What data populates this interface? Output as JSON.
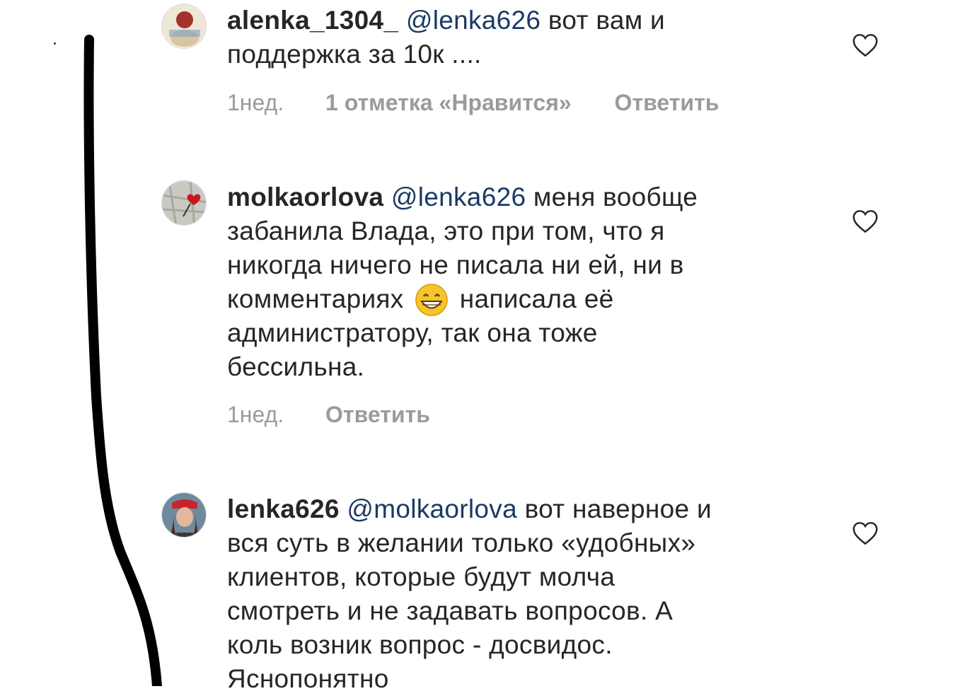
{
  "comments": [
    {
      "username": "alenka_1304_",
      "mention": "@lenka626",
      "text_first": " вот вам и",
      "text_rest": [
        "поддержка за 10к ...."
      ],
      "time": "1нед.",
      "likes": "1 отметка «Нравится»",
      "reply": "Ответить"
    },
    {
      "username": "molkaorlova",
      "mention": "@lenka626",
      "text_first": " меня вообще",
      "text_rest": [
        "забанила Влада, это при том, что я",
        "никогда ничего не писала ни ей, ни в"
      ],
      "emoji_line_before": "комментариях",
      "emoji_line_after": "написала её",
      "text_tail": [
        "администратору, так она тоже",
        "бессильна."
      ],
      "time": "1нед.",
      "reply": "Ответить"
    },
    {
      "username": "lenka626",
      "mention": "@molkaorlova",
      "text_first": " вот наверное и",
      "text_rest": [
        "вся суть в желании только «удобных»",
        "клиентов, которые будут молча",
        "смотреть и не задавать вопросов. А",
        "коль возник вопрос - досвидос.",
        "Яснопонятно"
      ]
    }
  ],
  "icons": {
    "like": "heart-outline-icon",
    "emoji": "grinning-face-emoji"
  }
}
